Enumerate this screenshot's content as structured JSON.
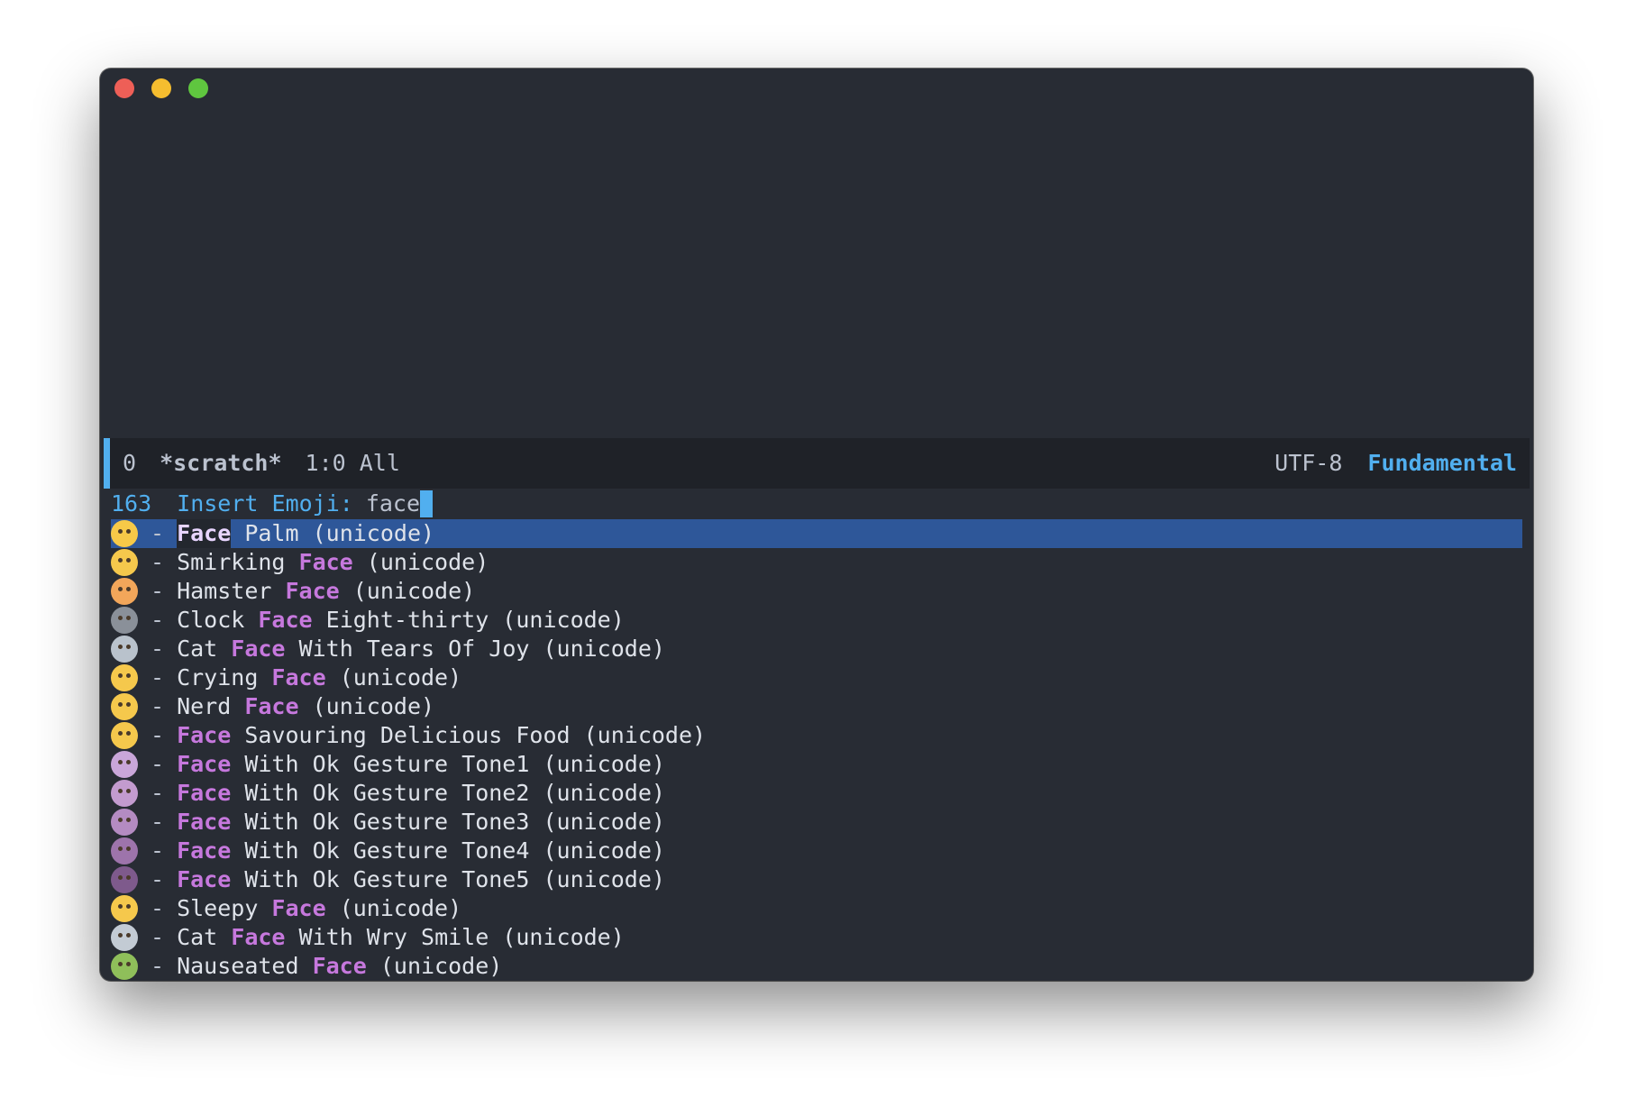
{
  "window": {
    "colors": {
      "close": "#ee5f57",
      "minimize": "#f5bd2f",
      "maximize": "#5fc63f",
      "background": "#282c34",
      "accent": "#51afef",
      "match": "#c678dd",
      "selection": "#2e5799"
    }
  },
  "modeline": {
    "window_number": "0",
    "buffer_name": "*scratch*",
    "position": "1:0 All",
    "encoding": "UTF-8",
    "major_mode": "Fundamental"
  },
  "minibuffer": {
    "count": "163",
    "prompt": "Insert Emoji:",
    "input": "face",
    "separator": "-",
    "candidates": [
      {
        "icon": "face-palm-emoji",
        "icon_color": "#f7c948",
        "pre": "",
        "match": "Face",
        "post": " Palm (unicode)",
        "selected": true
      },
      {
        "icon": "smirking-face-emoji",
        "icon_color": "#f5c84c",
        "pre": "Smirking ",
        "match": "Face",
        "post": " (unicode)",
        "selected": false
      },
      {
        "icon": "hamster-face-emoji",
        "icon_color": "#f2a65a",
        "pre": "Hamster ",
        "match": "Face",
        "post": " (unicode)",
        "selected": false
      },
      {
        "icon": "clock-face-emoji",
        "icon_color": "#8a9099",
        "pre": "Clock ",
        "match": "Face",
        "post": " Eight-thirty (unicode)",
        "selected": false
      },
      {
        "icon": "cat-joy-emoji",
        "icon_color": "#b9c2cc",
        "pre": "Cat ",
        "match": "Face",
        "post": " With Tears Of Joy (unicode)",
        "selected": false
      },
      {
        "icon": "crying-face-emoji",
        "icon_color": "#f5c84c",
        "pre": "Crying ",
        "match": "Face",
        "post": " (unicode)",
        "selected": false
      },
      {
        "icon": "nerd-face-emoji",
        "icon_color": "#f5c84c",
        "pre": "Nerd ",
        "match": "Face",
        "post": " (unicode)",
        "selected": false
      },
      {
        "icon": "savouring-face-emoji",
        "icon_color": "#f5c84c",
        "pre": "",
        "match": "Face",
        "post": " Savouring Delicious Food (unicode)",
        "selected": false
      },
      {
        "icon": "ok-gesture-tone1-emoji",
        "icon_color": "#c9a6d9",
        "pre": "",
        "match": "Face",
        "post": " With Ok Gesture Tone1 (unicode)",
        "selected": false
      },
      {
        "icon": "ok-gesture-tone2-emoji",
        "icon_color": "#c39bcf",
        "pre": "",
        "match": "Face",
        "post": " With Ok Gesture Tone2 (unicode)",
        "selected": false
      },
      {
        "icon": "ok-gesture-tone3-emoji",
        "icon_color": "#b48bc2",
        "pre": "",
        "match": "Face",
        "post": " With Ok Gesture Tone3 (unicode)",
        "selected": false
      },
      {
        "icon": "ok-gesture-tone4-emoji",
        "icon_color": "#9d74ab",
        "pre": "",
        "match": "Face",
        "post": " With Ok Gesture Tone4 (unicode)",
        "selected": false
      },
      {
        "icon": "ok-gesture-tone5-emoji",
        "icon_color": "#7e5a8c",
        "pre": "",
        "match": "Face",
        "post": " With Ok Gesture Tone5 (unicode)",
        "selected": false
      },
      {
        "icon": "sleepy-face-emoji",
        "icon_color": "#f5c84c",
        "pre": "Sleepy ",
        "match": "Face",
        "post": " (unicode)",
        "selected": false
      },
      {
        "icon": "cat-wry-smile-emoji",
        "icon_color": "#c3cbd4",
        "pre": "Cat ",
        "match": "Face",
        "post": " With Wry Smile (unicode)",
        "selected": false
      },
      {
        "icon": "nauseated-face-emoji",
        "icon_color": "#8fbf5a",
        "pre": "Nauseated ",
        "match": "Face",
        "post": " (unicode)",
        "selected": false
      }
    ]
  }
}
